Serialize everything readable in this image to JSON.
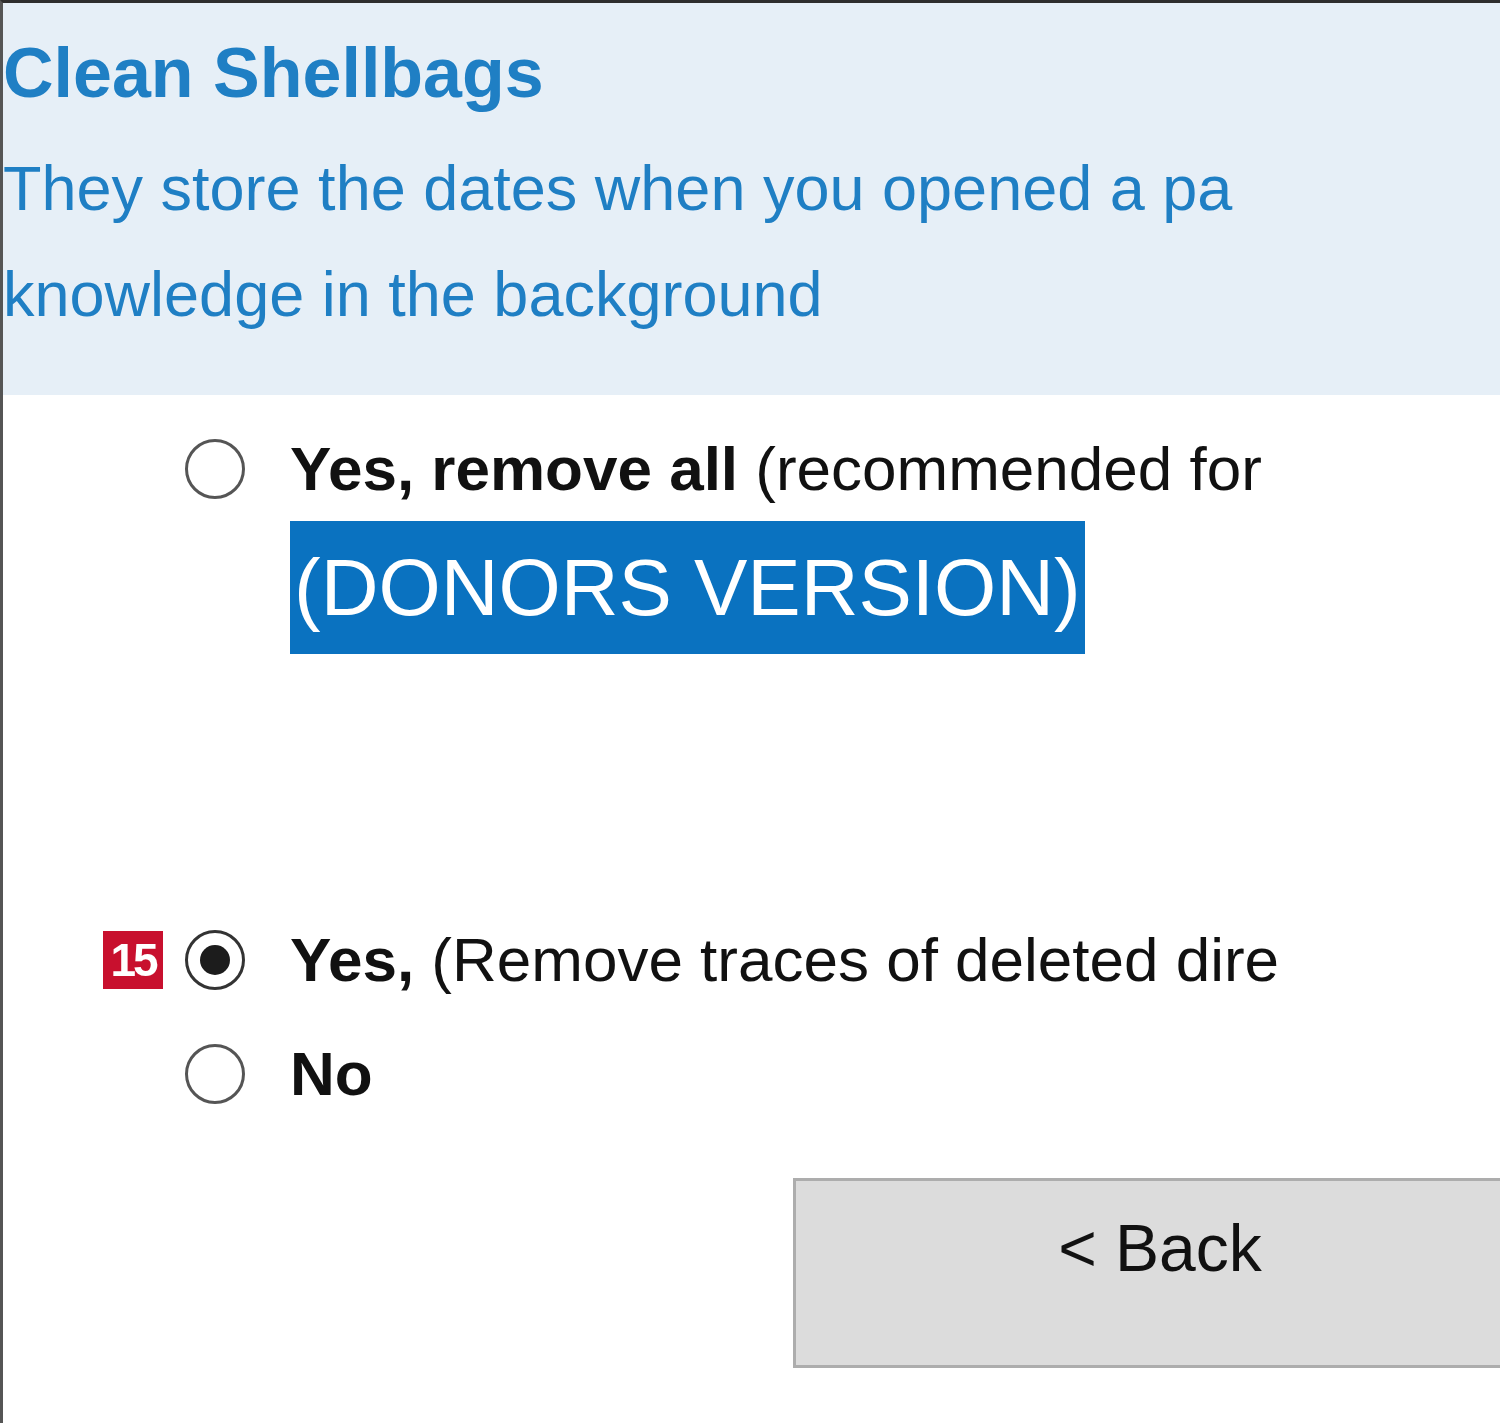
{
  "header": {
    "title": "Clean Shellbags",
    "description_lines": [
      "They store the dates when you opened a pa",
      "knowledge in the background"
    ]
  },
  "option_groups": [
    {
      "options": [
        {
          "label": "**Yes, remove all** (recommended for",
          "selected": false,
          "note": "(DONORS VERSION)"
        }
      ]
    },
    {
      "badge": "15",
      "options": [
        {
          "label": "**Yes,** (Remove traces of deleted dire",
          "selected": true
        },
        {
          "label": "**No**",
          "selected": false
        }
      ]
    }
  ],
  "buttons": [
    "< Back"
  ]
}
